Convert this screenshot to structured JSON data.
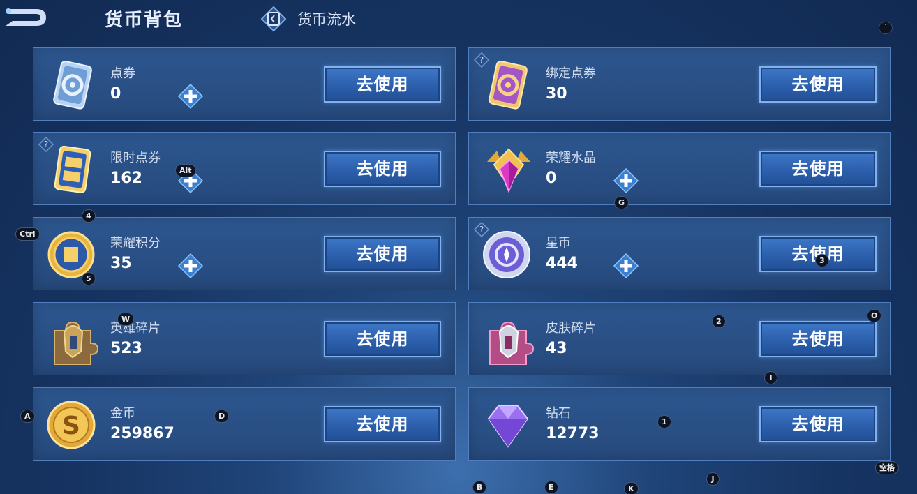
{
  "header": {
    "title": "货币背包",
    "flow_tab": "货币流水"
  },
  "cards": [
    {
      "name": "点券",
      "amount": "0",
      "button": "去使用"
    },
    {
      "name": "绑定点券",
      "amount": "30",
      "button": "去使用"
    },
    {
      "name": "限时点券",
      "amount": "162",
      "button": "去使用"
    },
    {
      "name": "荣耀水晶",
      "amount": "0",
      "button": "去使用"
    },
    {
      "name": "荣耀积分",
      "amount": "35",
      "button": "去使用"
    },
    {
      "name": "星币",
      "amount": "444",
      "button": "去使用"
    },
    {
      "name": "英雄碎片",
      "amount": "523",
      "button": "去使用"
    },
    {
      "name": "皮肤碎片",
      "amount": "43",
      "button": "去使用"
    },
    {
      "name": "金币",
      "amount": "259867",
      "button": "去使用"
    },
    {
      "name": "钻石",
      "amount": "12773",
      "button": "去使用"
    }
  ],
  "hotkeys": {
    "ctrl": "Ctrl",
    "alt": "Alt",
    "space": "空格",
    "k4": "4",
    "k5": "5",
    "w": "W",
    "a": "A",
    "d": "D",
    "g": "G",
    "k3": "3",
    "k2": "2",
    "o": "O",
    "i": "I",
    "k1": "1",
    "b": "B",
    "e": "E",
    "k": "K",
    "j": "J",
    "tick": "`"
  },
  "colors": {
    "background": "#163361",
    "card": "#2a5088",
    "card_border": "#4f7fbf",
    "button": "#2c5fac",
    "plus": "#67b3ff"
  },
  "icons": {
    "back": "back-arrow-icon",
    "flow": "currency-flow-icon",
    "help": "question-icon",
    "plus": "plus-icon"
  }
}
